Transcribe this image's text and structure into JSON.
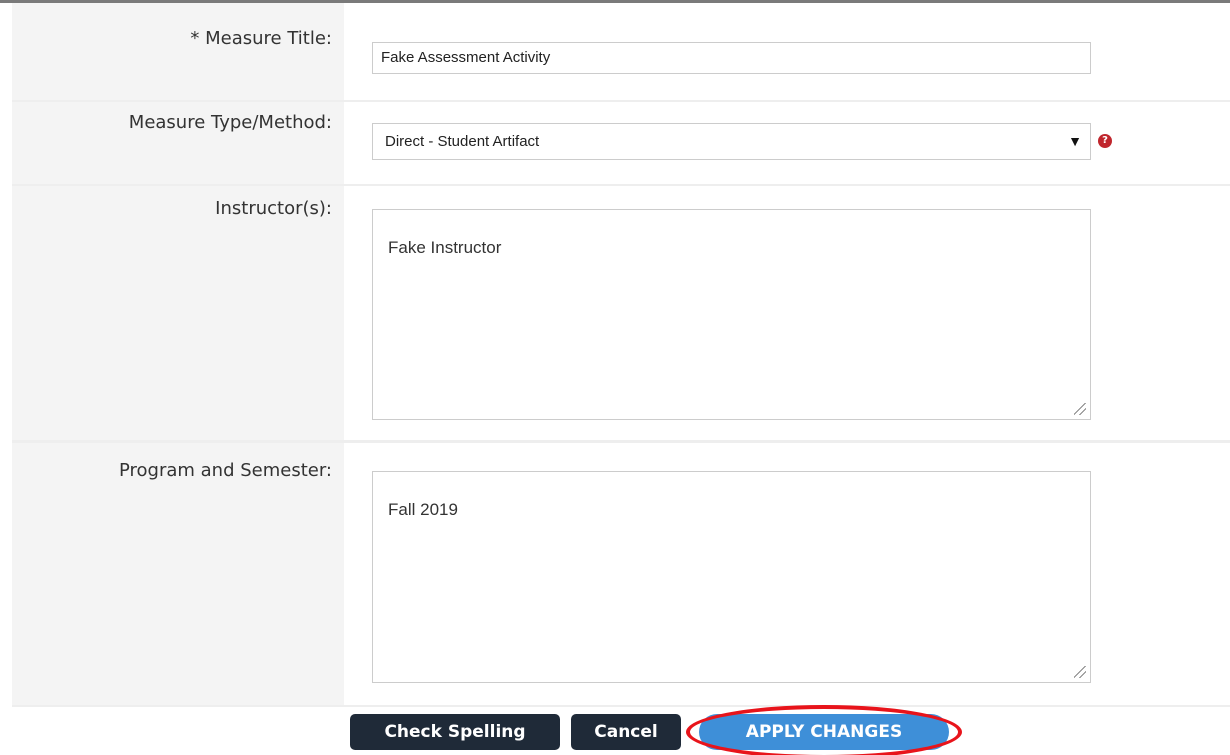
{
  "form": {
    "measure_title": {
      "label": "* Measure Title:",
      "value": "Fake Assessment Activity"
    },
    "measure_type": {
      "label": "Measure Type/Method:",
      "selected": "Direct - Student Artifact",
      "help_glyph": "?"
    },
    "instructors": {
      "label": "Instructor(s):",
      "value": "Fake Instructor"
    },
    "program_semester": {
      "label": "Program and Semester:",
      "value": "Fall 2019"
    }
  },
  "actions": {
    "check_spelling": "Check Spelling",
    "cancel": "Cancel",
    "apply_changes": "APPLY CHANGES"
  },
  "colors": {
    "dark_button": "#1f2a38",
    "primary_button": "#3e8fd8",
    "highlight_annotation": "#e8141b",
    "help_icon": "#c0262d"
  },
  "icons": {
    "select_arrow": "chevron-down-icon",
    "help": "help-icon",
    "resize": "resize-grip-icon"
  }
}
